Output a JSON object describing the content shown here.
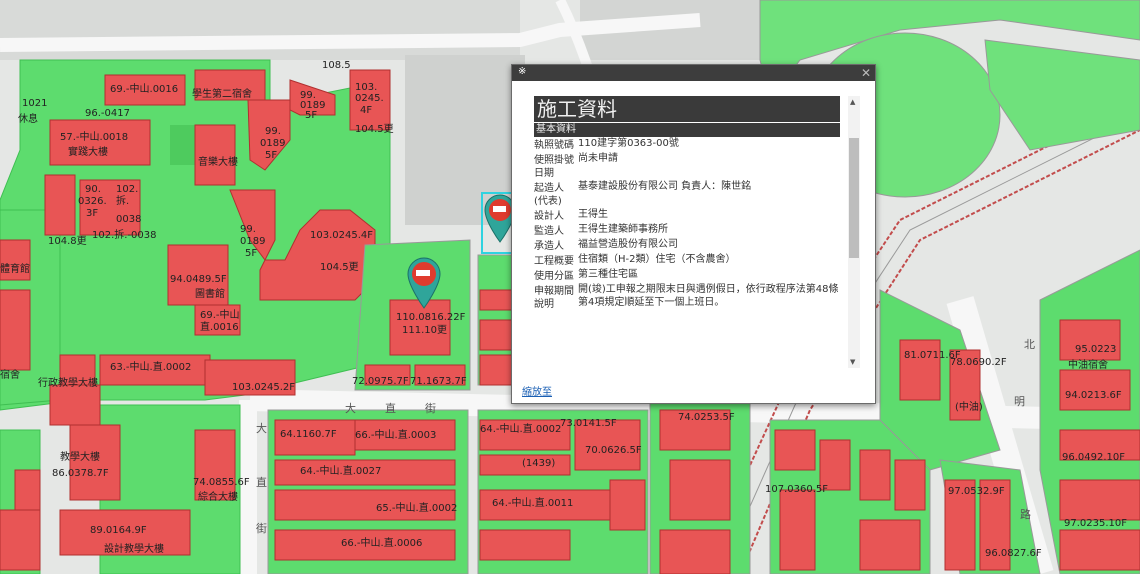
{
  "map": {
    "streets": {
      "dazhi": [
        "大",
        "直",
        "街"
      ],
      "jie_vertical": [
        "大",
        "直",
        "街"
      ],
      "right": [
        "北",
        "明",
        "路"
      ],
      "road_num": "108.5"
    },
    "labels": {
      "l01": "69.-中山.0016",
      "l02": "學生第二宿舍",
      "l03": "96.-0417",
      "l04": "57.-中山.0018",
      "l05": "實踐大樓",
      "l06": "音樂大樓",
      "l07": "99.",
      "l08": "0189",
      "l09": "5F",
      "l10": "103.",
      "l11": "0245.",
      "l12": "4F",
      "l13": "104.5更",
      "l14": "90.",
      "l15": "0326.",
      "l16": "3F",
      "l17": "102.",
      "l18": "拆.",
      "l19": "0038",
      "l20": "102.拆.-0038",
      "l21": "104.8更",
      "l22": "103.0245.4F",
      "l23": "104.5更",
      "l24": "94.0489.5F",
      "l25": "圖書館",
      "l26": "69.-中山",
      "l27": "直.0016",
      "l28": "63.-中山.直.0002",
      "l29": "行政教學大樓",
      "l30": "103.0245.2F",
      "l31": "110.0816.22F",
      "l32": "111.10更",
      "l33": "72.0975.7F",
      "l34": "71.1673.7F",
      "l35": "64.1160.7F",
      "l36": "66.-中山.直.0003",
      "l37": "64.-中山.直.0002",
      "l38": "73.0141.5F",
      "l39": "70.0626.5F",
      "l40": "(1439)",
      "l41": "64.-中山.直.0027",
      "l42": "64.-中山.直.0011",
      "l43": "65.-中山.直.0002",
      "l44": "66.-中山.直.0006",
      "l45": "74.0855.6F",
      "l46": "綜合大樓",
      "l47": "89.0164.9F",
      "l48": "設計教學大樓",
      "l49": "86.0378.7F",
      "l50": "教學大樓",
      "l51": "74.0253.5F",
      "l52": "81.0711.6F",
      "l53": "78.0690.2F",
      "l54": "(中油)",
      "l55": "95.0223",
      "l56": "中油宿舍",
      "l57": "94.0213.6F",
      "l58": "96.0492.10F",
      "l59": "97.0235.10F",
      "l60": "96.0827.6F",
      "l61": "107.0360.5F",
      "l62": "97.0532.9F",
      "l63": "體育館",
      "l64": "宿舍",
      "l65": "圖書館",
      "l66": "1021",
      "l67": "休息"
    }
  },
  "popup": {
    "pin_glyph": "※",
    "close_glyph": "✕",
    "heading": "施工資料",
    "section": "基本資料",
    "rows": [
      {
        "k": "執照號碼",
        "v": "110建字第0363-00號"
      },
      {
        "k": "使照掛號日期",
        "v": "尚未申請"
      },
      {
        "k": "起造人(代表)",
        "v": "基泰建設股份有限公司 負責人：陳世銘"
      },
      {
        "k": "設計人",
        "v": "王得生"
      },
      {
        "k": "監造人",
        "v": "王得生建築師事務所"
      },
      {
        "k": "承造人",
        "v": "福益營造股份有限公司"
      },
      {
        "k": "工程概要",
        "v": "住宿類（H-2類）住宅（不含農舍）"
      },
      {
        "k": "使用分區",
        "v": "第三種住宅區"
      },
      {
        "k": "申報期間說明",
        "v": "開(竣)工申報之期限末日與遇例假日，依行政程序法第48條第4項規定順延至下一個上班日。"
      }
    ],
    "link": "縮放至",
    "scroll_up": "▲",
    "scroll_down": "▼"
  },
  "colors": {
    "green": "#5ddc6e",
    "green_dark": "#3fbf52",
    "red": "#e85555",
    "red_outline": "#b03030",
    "road": "#f4f4f4",
    "gray_block": "#d0d2d0",
    "marker": "#2fa59a",
    "marker_red": "#e03b2e",
    "popup_dark": "#3d3d3d"
  }
}
